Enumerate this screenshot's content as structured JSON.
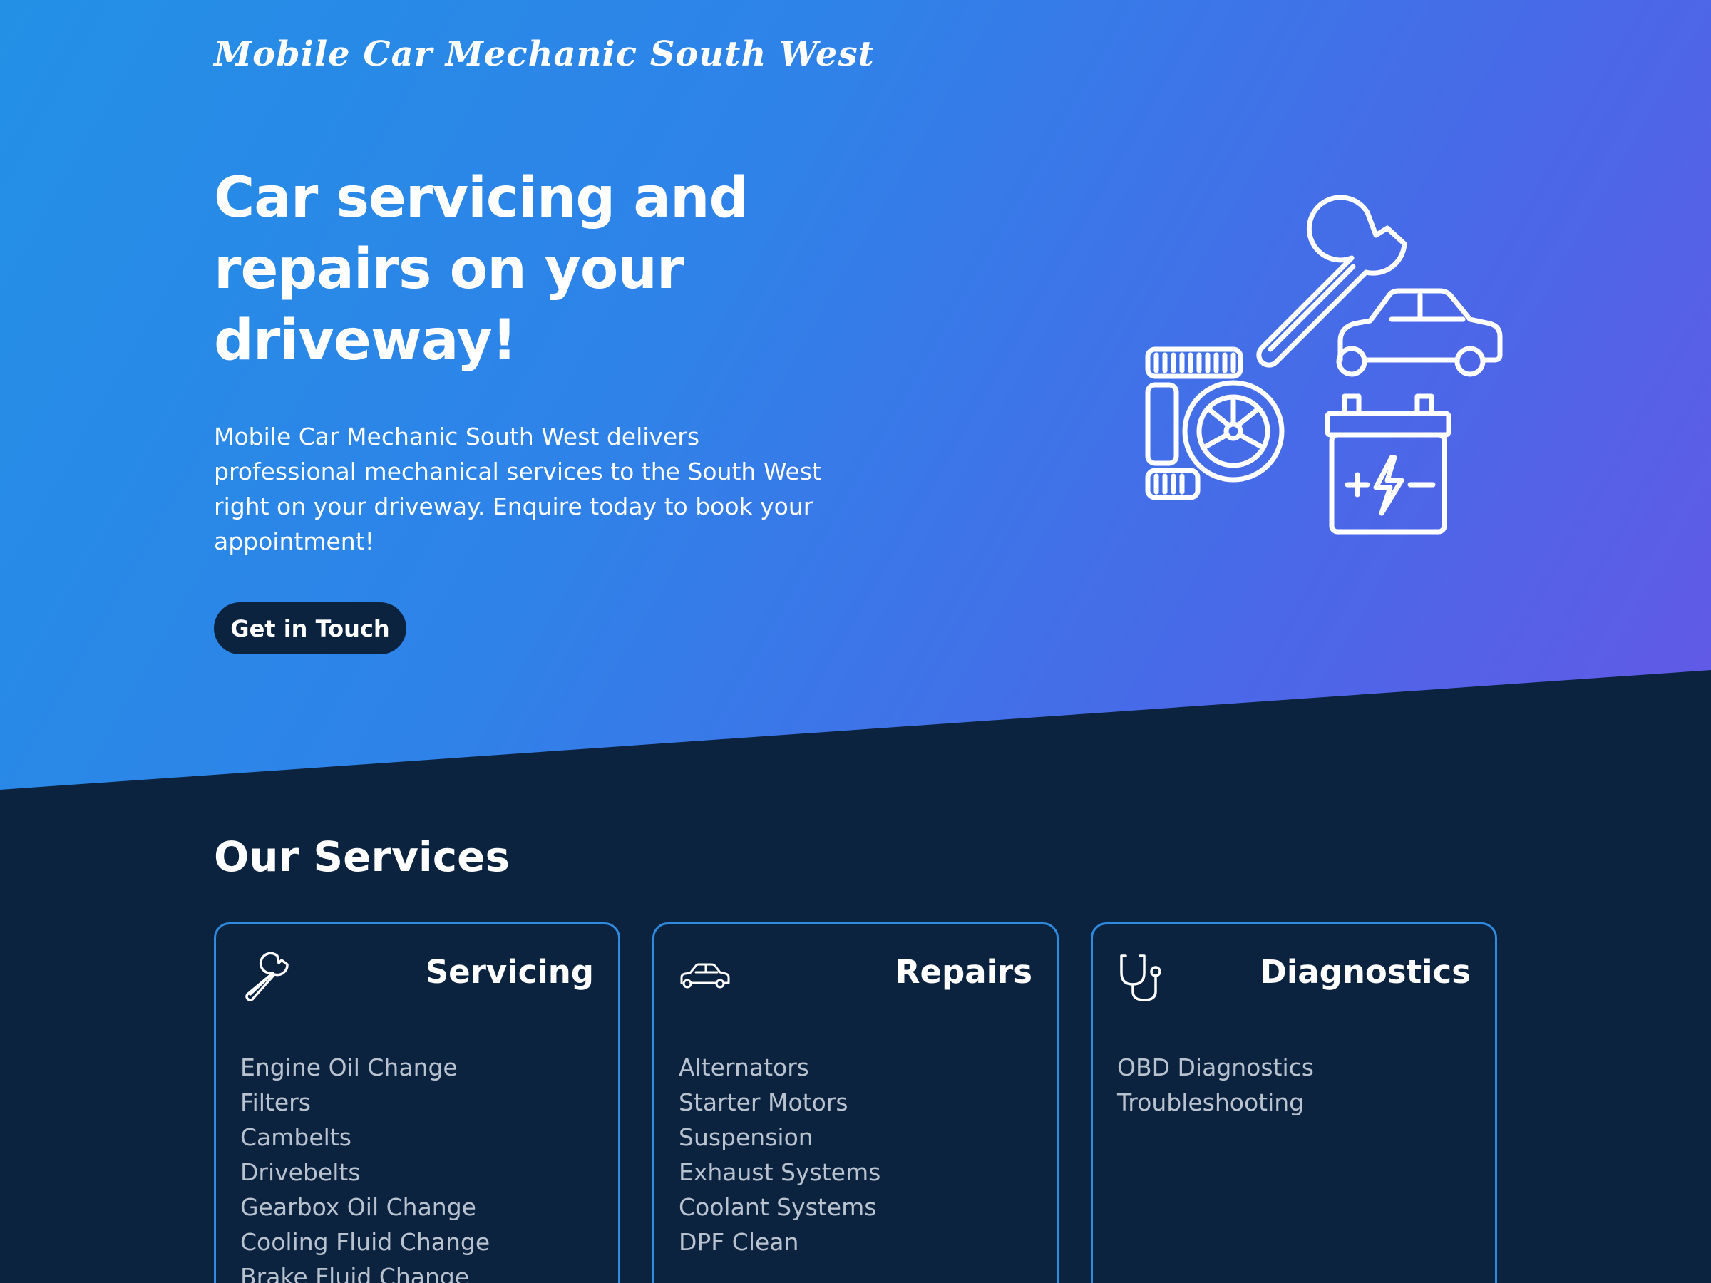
{
  "header": {
    "logo_text": "Mobile Car Mechanic South West"
  },
  "hero": {
    "headline_line1": "Car servicing and",
    "headline_line2": "repairs on your",
    "headline_line3": "driveway!",
    "intro_line1": "Mobile Car Mechanic South West delivers",
    "intro_line2": "professional mechanical services to the South West",
    "intro_line3": "right on your driveway. Enquire today to book your",
    "intro_line4": "appointment!",
    "cta_label": "Get in Touch",
    "illustration_icons": [
      "wrench-icon",
      "car-icon",
      "tyres-icon",
      "battery-icon"
    ]
  },
  "services": {
    "title": "Our Services",
    "cards": [
      {
        "title": "Servicing",
        "icon": "wrench-icon",
        "items": [
          "Engine Oil Change",
          "Filters",
          "Cambelts",
          "Drivebelts",
          "Gearbox Oil Change",
          "Cooling Fluid Change",
          "Brake Fluid Change"
        ]
      },
      {
        "title": "Repairs",
        "icon": "car-icon",
        "items": [
          "Alternators",
          "Starter Motors",
          "Suspension",
          "Exhaust Systems",
          "Coolant Systems",
          "DPF Clean"
        ]
      },
      {
        "title": "Diagnostics",
        "icon": "stethoscope-icon",
        "items": [
          "OBD Diagnostics",
          "Troubleshooting"
        ]
      }
    ]
  },
  "colors": {
    "hero_gradient_start": "#2390e6",
    "hero_gradient_end": "#6458e6",
    "navy": "#0c2340",
    "card_border": "#2f8be0",
    "list_text": "#b9c3d0"
  }
}
